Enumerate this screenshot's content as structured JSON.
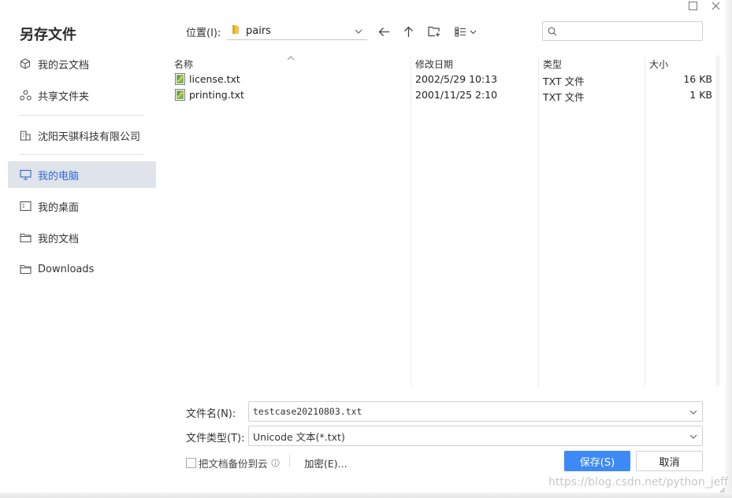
{
  "window": {
    "title": "另存文件",
    "controls": {
      "maximize_icon": "square-outline-icon",
      "close_icon": "close-icon"
    }
  },
  "sidebar": {
    "items": [
      {
        "label": "我的云文档",
        "icon": "cloud-cube-icon"
      },
      {
        "label": "共享文件夹",
        "icon": "share-nodes-icon"
      },
      {
        "label": "沈阳天骐科技有限公司",
        "icon": "building-icon"
      },
      {
        "label": "我的电脑",
        "icon": "monitor-icon",
        "active": true
      },
      {
        "label": "我的桌面",
        "icon": "desktop-icon"
      },
      {
        "label": "我的文档",
        "icon": "folder-icon"
      },
      {
        "label": "Downloads",
        "icon": "folder-icon"
      }
    ]
  },
  "location": {
    "label": "位置(I):",
    "value": "pairs",
    "icon": "folder-yellow-icon"
  },
  "toolbar": {
    "back_icon": "arrow-left-icon",
    "up_icon": "arrow-up-icon",
    "new_folder_icon": "new-folder-icon",
    "view_icon": "list-view-icon"
  },
  "search": {
    "placeholder": "",
    "icon": "search-icon"
  },
  "file_list": {
    "columns": [
      "名称",
      "修改日期",
      "类型",
      "大小"
    ],
    "rows": [
      {
        "name": "license.txt",
        "date": "2002/5/29 10:13",
        "type": "TXT 文件",
        "size": "16 KB"
      },
      {
        "name": "printing.txt",
        "date": "2001/11/25 2:10",
        "type": "TXT 文件",
        "size": "1 KB"
      }
    ]
  },
  "form": {
    "filename_label": "文件名(N):",
    "filename_value": "testcase20210803.txt",
    "filetype_label": "文件类型(T):",
    "filetype_value": "Unicode 文本(*.txt)",
    "backup_label": "把文档备份到云",
    "backup_info_icon": "info-icon",
    "encrypt_label": "加密(E)...",
    "save_label": "保存(S)",
    "cancel_label": "取消"
  },
  "watermark": "https://blog.csdn.net/python_jeff",
  "colors": {
    "accent": "#3d8af7",
    "active_bg": "#dfe3ea",
    "active_text": "#2d6bd3"
  }
}
